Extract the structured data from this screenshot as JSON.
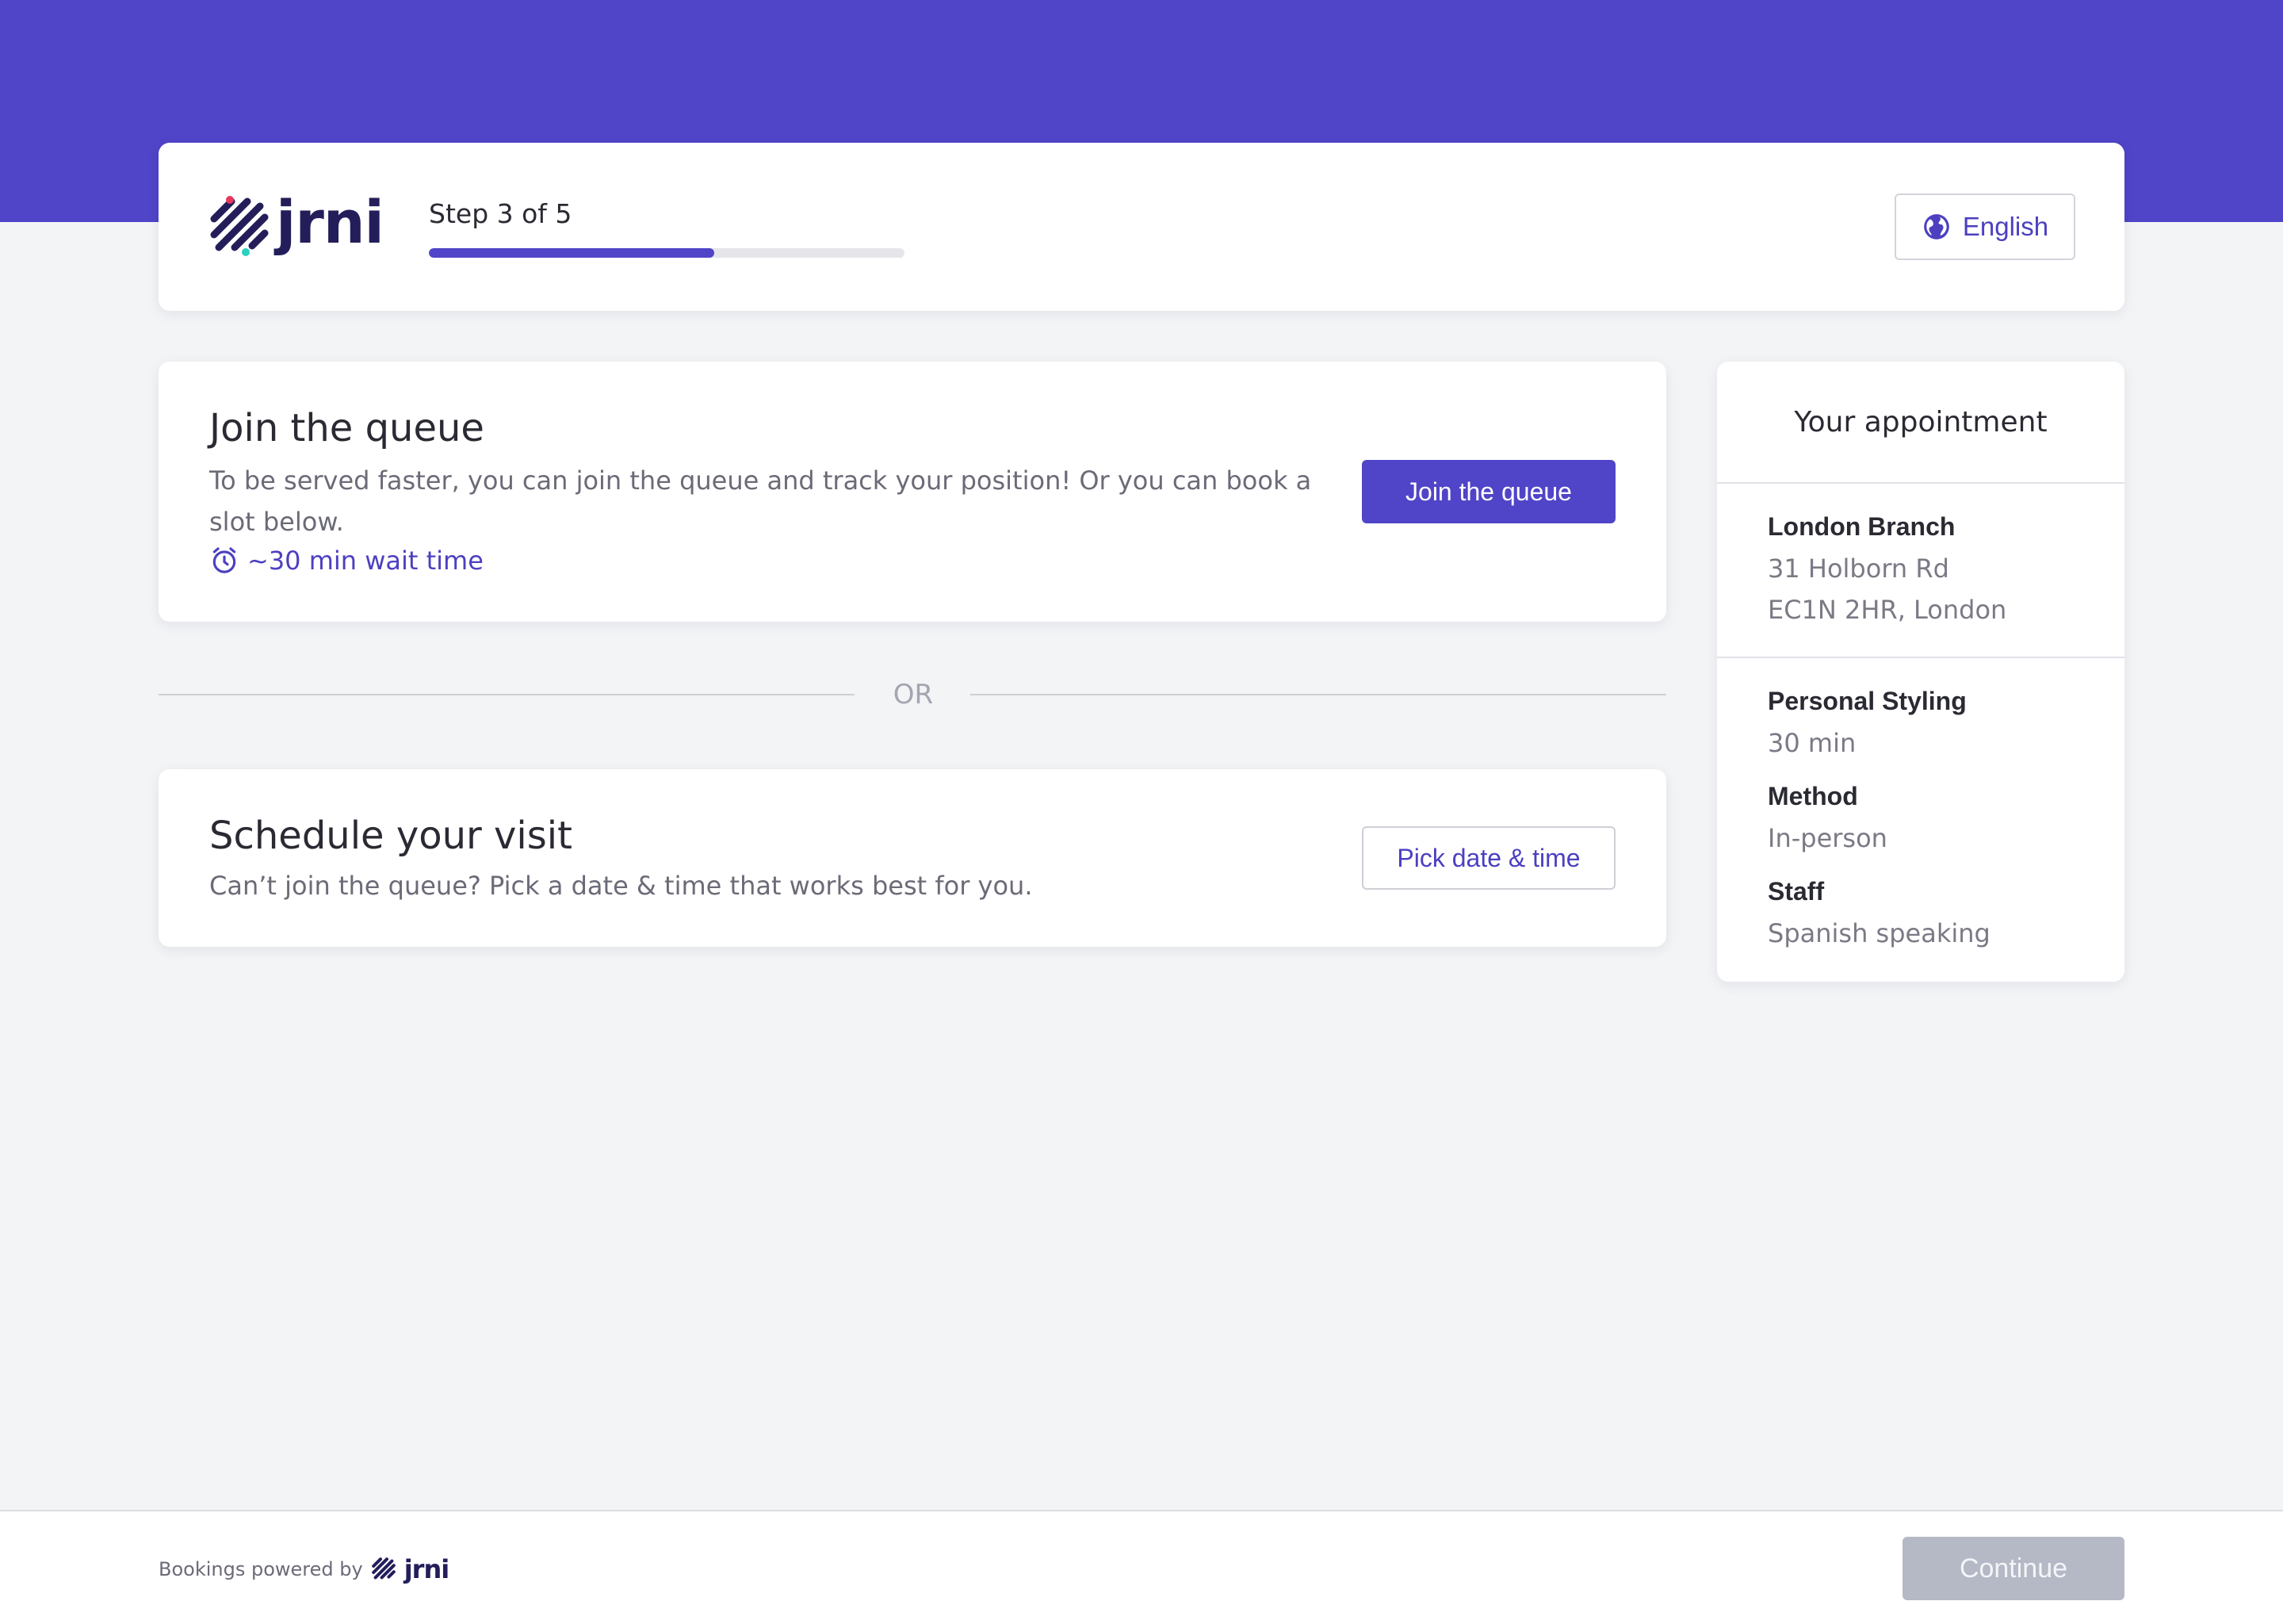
{
  "header": {
    "brand": "jrni",
    "step_label": "Step 3 of 5",
    "progress": 0.6,
    "language": "English"
  },
  "queue": {
    "title": "Join the queue",
    "description": "To be served faster, you can join the queue and track your position! Or you can book a slot below.",
    "wait_time": "~30 min wait time",
    "button": "Join the queue"
  },
  "divider": {
    "label": "OR"
  },
  "schedule": {
    "title": "Schedule your visit",
    "description": "Can’t join the queue? Pick a date & time that works best for you.",
    "button": "Pick date & time"
  },
  "appointment": {
    "title": "Your appointment",
    "branch_name": "London Branch",
    "address_line1": "31 Holborn Rd",
    "address_line2": "EC1N 2HR, London",
    "service_name": "Personal Styling",
    "service_duration": "30 min",
    "method_label": "Method",
    "method_value": "In-person",
    "staff_label": "Staff",
    "staff_value": "Spanish speaking"
  },
  "footer": {
    "powered_by": "Bookings powered by",
    "brand": "jrni",
    "continue": "Continue"
  },
  "colors": {
    "brand": "#5044c8",
    "brand_dark": "#231e5a",
    "background": "#f3f4f6",
    "disabled": "#b5b9c6"
  },
  "icons": {
    "logo": "jrni-stripes-logo-icon",
    "language": "globe-icon",
    "wait": "alarm-clock-icon"
  }
}
